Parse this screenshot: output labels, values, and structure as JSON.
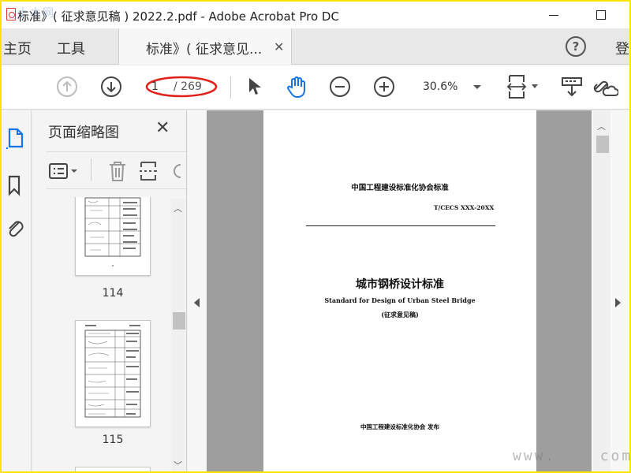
{
  "window": {
    "title": "标准》( 征求意见稿 ) 2022.2.pdf - Adobe Acrobat Pro DC",
    "watermark_top": "土木网",
    "watermark_bottom": "www.",
    "watermark_bottom_end": "com"
  },
  "tabs": {
    "home": "主页",
    "tools": "工具",
    "document": "标准》( 征求意见...",
    "close": "✕",
    "login": "登"
  },
  "toolbar": {
    "current_page": "1",
    "total_pages": "/ 269",
    "zoom": "30.6%",
    "annotation_color": "#e0211a"
  },
  "thumbnails": {
    "title": "页面缩略图",
    "close": "✕",
    "pages": [
      {
        "label": "114"
      },
      {
        "label": "115"
      }
    ]
  },
  "document": {
    "org": "中国工程建设标准化协会标准",
    "code": "T/CECS   XXX-20XX",
    "title_cn": "城市钢桥设计标准",
    "title_en": "Standard for Design of Urban Steel Bridge",
    "status": "(征求意见稿)",
    "publisher": "中国工程建设标准化协会   发布"
  },
  "colors": {
    "frame": "#ffe600",
    "accent_blue": "#1473e6"
  }
}
